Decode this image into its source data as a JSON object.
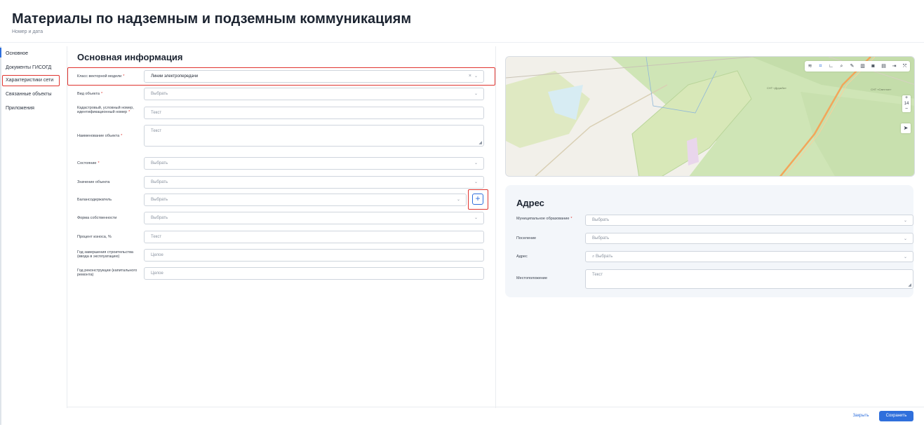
{
  "page": {
    "title": "Материалы по надземным и подземным коммуникациям",
    "subtitle": "Номер и дата"
  },
  "sidebar": {
    "items": [
      {
        "label": "Основное"
      },
      {
        "label": "Документы ГИСОГД"
      },
      {
        "label": "Характеристики сети"
      },
      {
        "label": "Связанные объекты"
      },
      {
        "label": "Приложения"
      }
    ]
  },
  "form": {
    "section_title": "Основная информация",
    "fields": [
      {
        "label": "Класс векторной модели",
        "required": "*",
        "value": "Линии электропередачи"
      },
      {
        "label": "Вид объекта",
        "required": "*",
        "value": "Выбрать"
      },
      {
        "label": "Кадастровый, условный номер, идентификационный номер",
        "required": "*",
        "value": "Текст"
      },
      {
        "label": "Наименование объекта",
        "required": "*",
        "value": "Текст"
      },
      {
        "label": "Состояние",
        "required": "*",
        "value": "Выбрать"
      },
      {
        "label": "Значение объекта",
        "required": "",
        "value": "Выбрать"
      },
      {
        "label": "Балансодержатель",
        "required": "",
        "value": "Выбрать"
      },
      {
        "label": "Форма собственности",
        "required": "",
        "value": "Выбрать"
      },
      {
        "label": "Процент износа, %",
        "required": "",
        "value": "Текст"
      },
      {
        "label": "Год завершения строительства (ввода в эксплуатацию)",
        "required": "",
        "value": "Целое"
      },
      {
        "label": "Год реконструкции (капитального ремонта)",
        "required": "",
        "value": "Целое"
      }
    ],
    "add_button": "+"
  },
  "icons": {
    "chevron": "⌄",
    "clear": "×",
    "resize": "◢"
  },
  "map": {
    "toolbar": [
      "layers-icon",
      "select-area-icon",
      "measure-icon",
      "search-icon",
      "draw-icon",
      "delete-icon",
      "camera-icon",
      "print-icon",
      "export-icon",
      "fullscreen-icon"
    ],
    "zoom_level": "14",
    "zoom_in": "+",
    "zoom_out": "−",
    "label_1": "СНТ «Дружба»",
    "label_2": "СНТ «Светлое»"
  },
  "address": {
    "title": "Адрес",
    "fields": [
      {
        "label": "Муниципальное образование",
        "required": "*",
        "value": "Выбрать"
      },
      {
        "label": "Поселение",
        "required": "",
        "value": "Выбрать"
      },
      {
        "label": "Адрес",
        "required": "",
        "value": "⌕ Выбрать"
      },
      {
        "label": "Местоположение",
        "required": "",
        "value": "Текст"
      }
    ]
  },
  "footer": {
    "close_label": "Закрыть",
    "save_label": "Сохранить"
  },
  "colors": {
    "accent": "#2f6fdc",
    "highlight": "#e0342f",
    "map_green": "#cfe5b6",
    "map_road": "#f2a65a"
  }
}
